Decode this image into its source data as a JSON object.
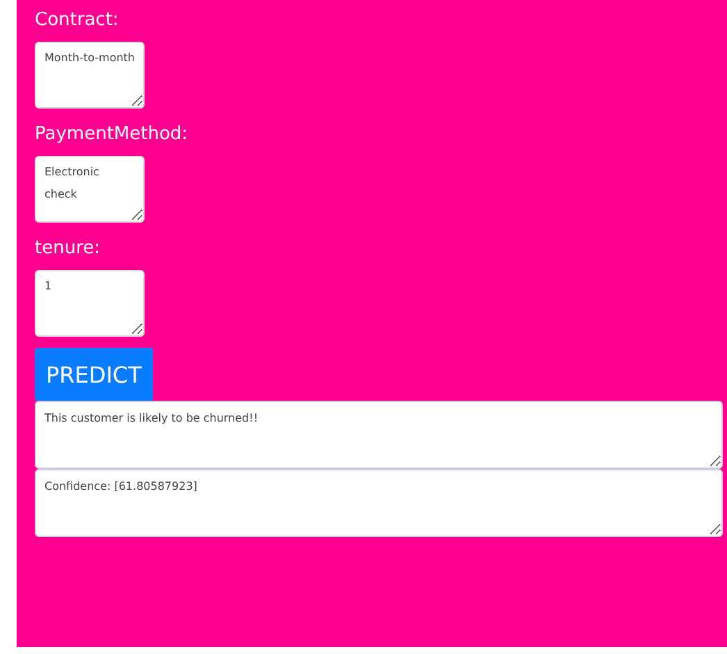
{
  "fields": [
    {
      "label": "Contract:",
      "value": "Month-to-month"
    },
    {
      "label": "PaymentMethod:",
      "value": "Electronic check"
    },
    {
      "label": "tenure:",
      "value": "1"
    }
  ],
  "predict_button": "PREDICT",
  "results": [
    {
      "value": "This customer is likely to be churned!!"
    },
    {
      "value": "Confidence: [61.80587923]"
    }
  ]
}
